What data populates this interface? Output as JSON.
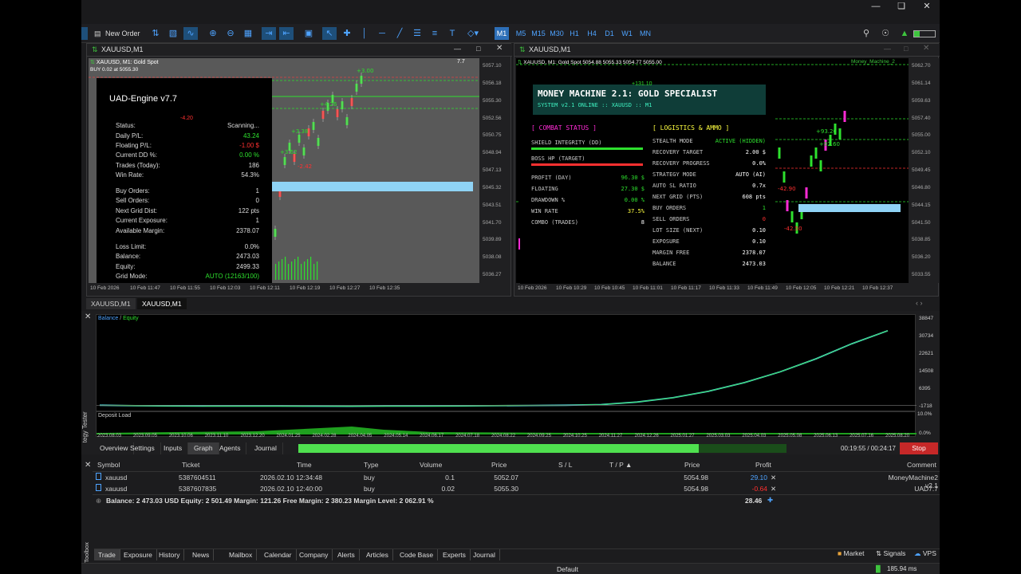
{
  "toolbar": {
    "new_order": "New Order",
    "timeframes": [
      "M1",
      "M5",
      "M15",
      "M30",
      "H1",
      "H4",
      "D1",
      "W1",
      "MN"
    ],
    "active_tf": "M1"
  },
  "window_left": {
    "title": "XAUUSD,M1",
    "chart_header": "XAUUSD, M1:  Gold Spot",
    "buy_line": "BUY 0.02 at 5055.30",
    "version_badge": "7.7",
    "price_scale": [
      "5057.10",
      "5056.18",
      "5055.30",
      "5052.56",
      "5050.75",
      "5048.94",
      "5047.13",
      "5045.32",
      "5043.51",
      "5041.70",
      "5039.89",
      "5038.08",
      "5036.27"
    ],
    "time_axis": [
      "10 Feb 2026",
      "10 Feb 11:47",
      "10 Feb 11:55",
      "10 Feb 12:03",
      "10 Feb 12:11",
      "10 Feb 12:19",
      "10 Feb 12:27",
      "10 Feb 12:35"
    ],
    "trade_labels": [
      "+3.00",
      "+4.26",
      "+3.38",
      "+3.62",
      "-4.20",
      "-2.42"
    ],
    "panel": {
      "title": "UAD-Engine v7.7",
      "rows": [
        {
          "label": "Status:",
          "value": "Scanning..."
        },
        {
          "label": "Daily P/L:",
          "value": "43.24"
        },
        {
          "label": "Floating P/L:",
          "value": "-1.00 $"
        },
        {
          "label": "Current DD %:",
          "value": "0.00 %"
        },
        {
          "label": "Trades (Today):",
          "value": "186"
        },
        {
          "label": "Win Rate:",
          "value": "54.3%"
        },
        {
          "label": "Buy Orders:",
          "value": "1"
        },
        {
          "label": "Sell Orders:",
          "value": "0"
        },
        {
          "label": "Next Grid Dist:",
          "value": "122 pts"
        },
        {
          "label": "Current Exposure:",
          "value": "1"
        },
        {
          "label": "Available Margin:",
          "value": "2378.07"
        },
        {
          "label": "Loss Limit:",
          "value": "0.0%"
        },
        {
          "label": "Balance:",
          "value": "2473.03"
        },
        {
          "label": "Equity:",
          "value": "2499.33"
        },
        {
          "label": "Grid Mode:",
          "value": "AUTO (12163/100)"
        }
      ]
    }
  },
  "window_right": {
    "title": "XAUUSD,M1",
    "chart_header": "XAUUSD, M1:  Gold Spot  5054.88 5055.33 5054.77 5055.00",
    "ea_name": "Money_Machine_2",
    "price_scale": [
      "5062.70",
      "5061.14",
      "5059.63",
      "5057.40",
      "5055.00",
      "5052.10",
      "5049.45",
      "5046.80",
      "5044.15",
      "5041.50",
      "5038.85",
      "5036.20",
      "5033.55"
    ],
    "time_axis": [
      "10 Feb 2026",
      "10 Feb 10:29",
      "10 Feb 10:45",
      "10 Feb 11:01",
      "10 Feb 11:17",
      "10 Feb 11:33",
      "10 Feb 11:49",
      "10 Feb 12:05",
      "10 Feb 12:21",
      "10 Feb 12:37"
    ],
    "trade_labels": [
      "+131.10",
      "+93.20",
      "+92.60",
      "-42.90",
      "-43.60",
      "-42.50"
    ],
    "panel": {
      "title": "MONEY MACHINE 2.1: GOLD SPECIALIST",
      "subtitle": "SYSTEM v2.1 ONLINE :: XAUUSD :: M1",
      "combat_header": "[ COMBAT STATUS ]",
      "shield": "SHIELD INTEGRITY (DD)",
      "boss": "BOSS HP (TARGET)",
      "combat_rows": [
        {
          "label": "PROFIT (DAY)",
          "value": "96.30 $"
        },
        {
          "label": "FLOATING",
          "value": "27.30 $"
        },
        {
          "label": "DRAWDOWN %",
          "value": "0.00 %"
        },
        {
          "label": "WIN RATE",
          "value": "37.5%"
        },
        {
          "label": "COMBO (TRADES)",
          "value": "8"
        }
      ],
      "logistics_header": "[ LOGISTICS & AMMO ]",
      "log_rows": [
        {
          "label": "STEALTH MODE",
          "value": "ACTIVE (HIDDEN)"
        },
        {
          "label": "RECOVERY TARGET",
          "value": "2.00 $"
        },
        {
          "label": "RECOVERY PROGRESS",
          "value": "0.0%"
        },
        {
          "label": "STRATEGY MODE",
          "value": "AUTO (AI)"
        },
        {
          "label": "AUTO SL RATIO",
          "value": "0.7x"
        },
        {
          "label": "NEXT GRID (PTS)",
          "value": "608 pts"
        },
        {
          "label": "BUY ORDERS",
          "value": "1"
        },
        {
          "label": "SELL ORDERS",
          "value": "0"
        },
        {
          "label": "LOT SIZE (NEXT)",
          "value": "0.10"
        },
        {
          "label": "EXPOSURE",
          "value": "0.10"
        },
        {
          "label": "MARGIN FREE",
          "value": "2378.07"
        },
        {
          "label": "BALANCE",
          "value": "2473.03"
        }
      ]
    }
  },
  "chart_tabs": [
    "XAUUSD,M1",
    "XAUUSD,M1"
  ],
  "tester": {
    "legend_balance": "Balance",
    "legend_sep": " / ",
    "legend_equity": "Equity",
    "y_axis": [
      "38847",
      "30734",
      "22621",
      "14508",
      "6395",
      "-1718"
    ],
    "deposit_label": "Deposit Load",
    "deposit_axis": [
      "10.0%",
      "0.0%"
    ],
    "x_axis": [
      "2023.08.03",
      "2023.09.05",
      "2023.10.06",
      "2023.11.10",
      "2023.12.20",
      "2024.01.25",
      "2024.02.28",
      "2024.04.05",
      "2024.05.14",
      "2024.06.17",
      "2024.07.18",
      "2024.08.22",
      "2024.09.25",
      "2024.10.25",
      "2024.11.27",
      "2024.12.26",
      "2025.01.27",
      "2025.03.03",
      "2025.04.03",
      "2025.05.08",
      "2025.06.13",
      "2025.07.16",
      "2025.08.20"
    ],
    "side_label": "Strategy Tester",
    "tabs": [
      "Overview",
      "Settings",
      "Inputs",
      "Graph",
      "Agents",
      "Journal"
    ],
    "active_tab": "Graph",
    "progress": 0.82,
    "timer": "00:19:55 / 00:24:17",
    "stop": "Stop",
    "chart_data": {
      "type": "line",
      "series": [
        {
          "name": "Balance",
          "values": [
            0,
            -200,
            -300,
            -400,
            -350,
            -380,
            -420,
            -450,
            -400,
            -380,
            -300,
            -200,
            -100,
            0,
            300,
            1500,
            3500,
            6500,
            10500,
            15500,
            21500,
            28500,
            34500
          ]
        },
        {
          "name": "Equity",
          "values": [
            0,
            -200,
            -300,
            -400,
            -350,
            -380,
            -420,
            -450,
            -400,
            -380,
            -300,
            -200,
            -100,
            0,
            300,
            1500,
            3500,
            6500,
            10500,
            15500,
            21500,
            28500,
            34500
          ]
        }
      ],
      "ylim": [
        -1718,
        38847
      ]
    }
  },
  "trades": {
    "headers": [
      "Symbol",
      "Ticket",
      "Time",
      "Type",
      "Volume",
      "Price",
      "S / L",
      "T / P",
      "Price",
      "Profit",
      "Comment"
    ],
    "rows": [
      {
        "symbol": "xauusd",
        "ticket": "5387604511",
        "time": "2026.02.10 12:34:48",
        "type": "buy",
        "volume": "0.1",
        "price": "5052.07",
        "cur": "5054.98",
        "profit": "29.10",
        "comment": "MoneyMachine2 v2.1"
      },
      {
        "symbol": "xauusd",
        "ticket": "5387607835",
        "time": "2026.02.10 12:40:00",
        "type": "buy",
        "volume": "0.02",
        "price": "5055.30",
        "cur": "5054.98",
        "profit": "-0.64",
        "comment": "UAD7.7"
      }
    ],
    "summary": "Balance: 2 473.03 USD  Equity: 2 501.49  Margin: 121.26  Free Margin: 2 380.23  Margin Level: 2 062.91 %",
    "total": "28.46",
    "side_label": "Toolbox"
  },
  "bottom_tabs": [
    "Trade",
    "Exposure",
    "History",
    "News",
    "Mailbox",
    "Calendar",
    "Company",
    "Alerts",
    "Articles",
    "Code Base",
    "Experts",
    "Journal"
  ],
  "news_count": "",
  "bottom_right": [
    "Market",
    "Signals",
    "VPS"
  ],
  "status": {
    "profile": "Default",
    "ping": "185.94 ms"
  }
}
